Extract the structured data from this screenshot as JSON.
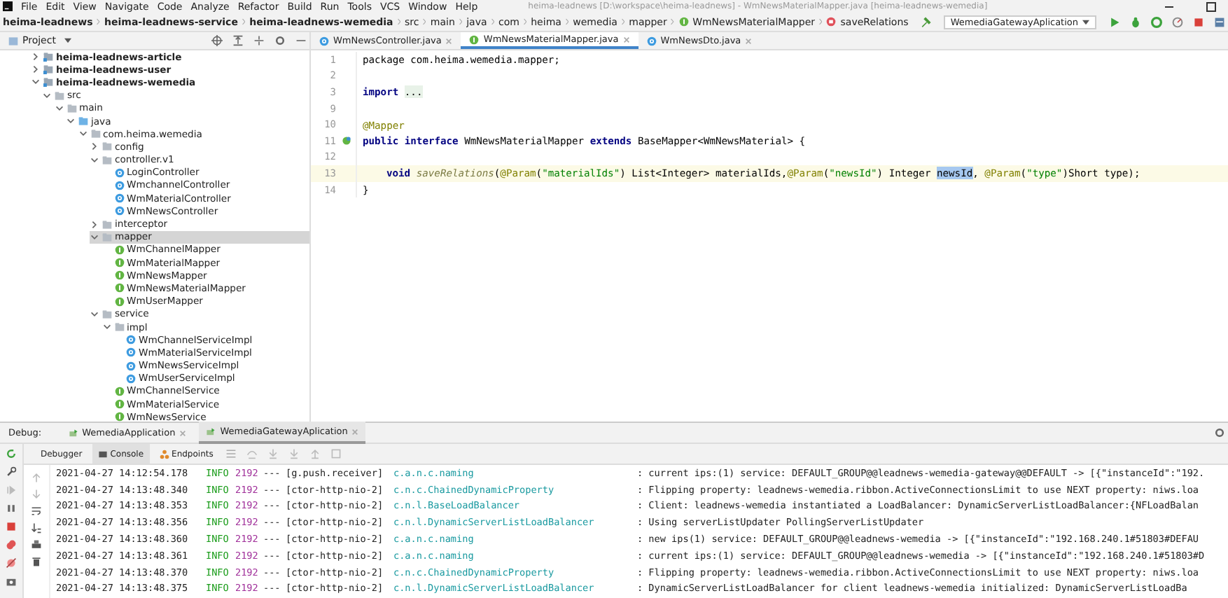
{
  "menu": [
    "File",
    "Edit",
    "View",
    "Navigate",
    "Code",
    "Analyze",
    "Refactor",
    "Build",
    "Run",
    "Tools",
    "VCS",
    "Window",
    "Help"
  ],
  "window": {
    "title": "heima-leadnews [D:\\workspace\\heima-leadnews] - WmNewsMaterialMapper.java [heima-leadnews-wemedia]"
  },
  "breadcrumbs": [
    {
      "label": "heima-leadnews",
      "kind": "module"
    },
    {
      "label": "heima-leadnews-service",
      "kind": "module"
    },
    {
      "label": "heima-leadnews-wemedia",
      "kind": "module"
    },
    {
      "label": "src",
      "kind": "folder"
    },
    {
      "label": "main",
      "kind": "folder"
    },
    {
      "label": "java",
      "kind": "folder"
    },
    {
      "label": "com",
      "kind": "folder"
    },
    {
      "label": "heima",
      "kind": "folder"
    },
    {
      "label": "wemedia",
      "kind": "folder"
    },
    {
      "label": "mapper",
      "kind": "folder"
    },
    {
      "label": "WmNewsMaterialMapper",
      "kind": "interface"
    },
    {
      "label": "saveRelations",
      "kind": "method"
    }
  ],
  "run_config": "WemediaGatewayAplication",
  "project_panel": {
    "title": "Project"
  },
  "editor_tabs": [
    {
      "label": "WmNewsController.java",
      "kind": "class",
      "selected": false
    },
    {
      "label": "WmNewsMaterialMapper.java",
      "kind": "interface",
      "selected": true
    },
    {
      "label": "WmNewsDto.java",
      "kind": "class",
      "selected": false
    }
  ],
  "tree": [
    {
      "label": "heima-leadnews-article",
      "kind": "module",
      "expanded": false,
      "selected": false
    },
    {
      "label": "heima-leadnews-user",
      "kind": "module",
      "expanded": false,
      "selected": false
    },
    {
      "label": "heima-leadnews-wemedia",
      "kind": "module",
      "expanded": true,
      "selected": false,
      "children": [
        {
          "label": "src",
          "kind": "folder",
          "expanded": true,
          "selected": false,
          "children": [
            {
              "label": "main",
              "kind": "folder",
              "expanded": true,
              "selected": false,
              "children": [
                {
                  "label": "java",
                  "kind": "source",
                  "expanded": true,
                  "selected": false,
                  "children": [
                    {
                      "label": "com.heima.wemedia",
                      "kind": "folder",
                      "expanded": true,
                      "selected": false,
                      "children": [
                        {
                          "label": "config",
                          "kind": "folder",
                          "expanded": false,
                          "selected": false
                        },
                        {
                          "label": "controller.v1",
                          "kind": "folder",
                          "expanded": true,
                          "selected": false,
                          "children": [
                            {
                              "label": "LoginController",
                              "kind": "class",
                              "selected": false
                            },
                            {
                              "label": "WmchannelController",
                              "kind": "class",
                              "selected": false
                            },
                            {
                              "label": "WmMaterialController",
                              "kind": "class",
                              "selected": false
                            },
                            {
                              "label": "WmNewsController",
                              "kind": "class",
                              "selected": false
                            }
                          ]
                        },
                        {
                          "label": "interceptor",
                          "kind": "folder",
                          "expanded": false,
                          "selected": false
                        },
                        {
                          "label": "mapper",
                          "kind": "folder",
                          "expanded": true,
                          "selected": true,
                          "children": [
                            {
                              "label": "WmChannelMapper",
                              "kind": "interface",
                              "selected": false
                            },
                            {
                              "label": "WmMaterialMapper",
                              "kind": "interface",
                              "selected": false
                            },
                            {
                              "label": "WmNewsMapper",
                              "kind": "interface",
                              "selected": false
                            },
                            {
                              "label": "WmNewsMaterialMapper",
                              "kind": "interface",
                              "selected": false
                            },
                            {
                              "label": "WmUserMapper",
                              "kind": "interface",
                              "selected": false
                            }
                          ]
                        },
                        {
                          "label": "service",
                          "kind": "folder",
                          "expanded": true,
                          "selected": false,
                          "children": [
                            {
                              "label": "impl",
                              "kind": "folder",
                              "expanded": true,
                              "selected": false,
                              "children": [
                                {
                                  "label": "WmChannelServiceImpl",
                                  "kind": "class",
                                  "selected": false
                                },
                                {
                                  "label": "WmMaterialServiceImpl",
                                  "kind": "class",
                                  "selected": false
                                },
                                {
                                  "label": "WmNewsServiceImpl",
                                  "kind": "class",
                                  "selected": false
                                },
                                {
                                  "label": "WmUserServiceImpl",
                                  "kind": "class",
                                  "selected": false
                                }
                              ]
                            },
                            {
                              "label": "WmChannelService",
                              "kind": "interface",
                              "selected": false
                            },
                            {
                              "label": "WmMaterialService",
                              "kind": "interface",
                              "selected": false
                            },
                            {
                              "label": "WmNewsService",
                              "kind": "interface",
                              "selected": false
                            }
                          ]
                        }
                      ]
                    }
                  ]
                }
              ]
            }
          ]
        }
      ]
    }
  ],
  "code_lines": [
    {
      "number": "1",
      "current": false,
      "tokens": [
        {
          "kind": "plain",
          "text": "package com.heima.wemedia.mapper;"
        }
      ]
    },
    {
      "number": "2",
      "current": false
    },
    {
      "number": "3",
      "current": false,
      "tokens": [
        {
          "kind": "keyword",
          "text": "import "
        },
        {
          "kind": "fold",
          "text": "..."
        }
      ]
    },
    {
      "number": "9",
      "current": false
    },
    {
      "number": "10",
      "current": false,
      "tokens": [
        {
          "kind": "annotation",
          "text": "@Mapper"
        }
      ]
    },
    {
      "number": "11",
      "current": false,
      "tokens": [
        {
          "kind": "keyword",
          "text": "public interface"
        },
        {
          "kind": "plain",
          "text": " WmNewsMaterialMapper "
        },
        {
          "kind": "keyword",
          "text": "extends"
        },
        {
          "kind": "plain",
          "text": " BaseMapper<WmNewsMaterial> {"
        }
      ]
    },
    {
      "number": "12",
      "current": false
    },
    {
      "number": "13",
      "current": true,
      "indented": true,
      "tokens": [
        {
          "kind": "keyword",
          "text": "void "
        },
        {
          "kind": "method",
          "text": "saveRelations"
        },
        {
          "kind": "plain",
          "text": "("
        },
        {
          "kind": "annotation",
          "text": "@Param"
        },
        {
          "kind": "plain",
          "text": "("
        },
        {
          "kind": "string",
          "text": "\"materialIds\""
        },
        {
          "kind": "plain",
          "text": ") List<Integer> materialIds,"
        },
        {
          "kind": "annotation",
          "text": "@Param"
        },
        {
          "kind": "plain",
          "text": "("
        },
        {
          "kind": "string",
          "text": "\"newsId\""
        },
        {
          "kind": "plain",
          "text": ") Integer "
        },
        {
          "kind": "selected",
          "text": "newsId"
        },
        {
          "kind": "plain",
          "text": ", "
        },
        {
          "kind": "annotation",
          "text": "@Param"
        },
        {
          "kind": "plain",
          "text": "("
        },
        {
          "kind": "string",
          "text": "\"type\""
        },
        {
          "kind": "plain",
          "text": ")Short type);"
        }
      ]
    },
    {
      "number": "14",
      "current": false,
      "tokens": [
        {
          "kind": "plain",
          "text": "}"
        }
      ]
    }
  ],
  "debug": {
    "label": "Debug:",
    "tabs": [
      {
        "label": "WemediaApplication",
        "selected": false
      },
      {
        "label": "WemediaGatewayAplication",
        "selected": true
      }
    ],
    "subtabs": [
      {
        "label": "Debugger",
        "kind": "plain",
        "selected": false
      },
      {
        "label": "Console",
        "kind": "console",
        "selected": true
      },
      {
        "label": "Endpoints",
        "kind": "endpoints",
        "selected": false
      }
    ]
  },
  "log": [
    {
      "time": "2021-04-27 14:12:54.178",
      "level": "INFO",
      "pid": "2192",
      "sep": "---",
      "thread": "[g.push.receiver]",
      "logger": "c.a.n.c.naming",
      "message": ": current ips:(1) service: DEFAULT_GROUP@@leadnews-wemedia-gateway@@DEFAULT -> [{\"instanceId\":\"192."
    },
    {
      "time": "2021-04-27 14:13:48.340",
      "level": "INFO",
      "pid": "2192",
      "sep": "---",
      "thread": "[ctor-http-nio-2]",
      "logger": "c.n.c.ChainedDynamicProperty",
      "message": ": Flipping property: leadnews-wemedia.ribbon.ActiveConnectionsLimit to use NEXT property: niws.loa"
    },
    {
      "time": "2021-04-27 14:13:48.353",
      "level": "INFO",
      "pid": "2192",
      "sep": "---",
      "thread": "[ctor-http-nio-2]",
      "logger": "c.n.l.BaseLoadBalancer",
      "message": ": Client: leadnews-wemedia instantiated a LoadBalancer: DynamicServerListLoadBalancer:{NFLoadBalan"
    },
    {
      "time": "2021-04-27 14:13:48.356",
      "level": "INFO",
      "pid": "2192",
      "sep": "---",
      "thread": "[ctor-http-nio-2]",
      "logger": "c.n.l.DynamicServerListLoadBalancer",
      "message": ": Using serverListUpdater PollingServerListUpdater"
    },
    {
      "time": "2021-04-27 14:13:48.360",
      "level": "INFO",
      "pid": "2192",
      "sep": "---",
      "thread": "[ctor-http-nio-2]",
      "logger": "c.a.n.c.naming",
      "message": ": new ips(1) service: DEFAULT_GROUP@@leadnews-wemedia -> [{\"instanceId\":\"192.168.240.1#51803#DEFAU"
    },
    {
      "time": "2021-04-27 14:13:48.361",
      "level": "INFO",
      "pid": "2192",
      "sep": "---",
      "thread": "[ctor-http-nio-2]",
      "logger": "c.a.n.c.naming",
      "message": ": current ips:(1) service: DEFAULT_GROUP@@leadnews-wemedia -> [{\"instanceId\":\"192.168.240.1#51803#D"
    },
    {
      "time": "2021-04-27 14:13:48.370",
      "level": "INFO",
      "pid": "2192",
      "sep": "---",
      "thread": "[ctor-http-nio-2]",
      "logger": "c.n.c.ChainedDynamicProperty",
      "message": ": Flipping property: leadnews-wemedia.ribbon.ActiveConnectionsLimit to use NEXT property: niws.loa"
    },
    {
      "time": "2021-04-27 14:13:48.375",
      "level": "INFO",
      "pid": "2192",
      "sep": "---",
      "thread": "[ctor-http-nio-2]",
      "logger": "c.n.l.DynamicServerListLoadBalancer",
      "message": ": DynamicServerListLoadBalancer for client leadnews-wemedia initialized: DynamicServerListLoadBa"
    }
  ]
}
